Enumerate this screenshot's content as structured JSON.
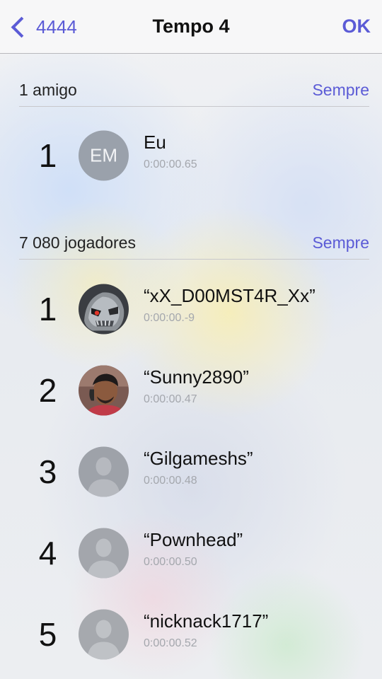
{
  "navbar": {
    "back_label": "4444",
    "title": "Tempo 4",
    "ok_label": "OK"
  },
  "friends": {
    "title": "1 amigo",
    "filter": "Sempre",
    "entries": [
      {
        "rank": "1",
        "name": "Eu",
        "score": "0:00:00.65",
        "avatar": "initials",
        "initials": "EM"
      }
    ]
  },
  "players": {
    "title": "7 080 jogadores",
    "filter": "Sempre",
    "entries": [
      {
        "rank": "1",
        "name": "“xX_D00MST4R_Xx”",
        "score": "0:00:00.-9",
        "avatar": "skull-photo"
      },
      {
        "rank": "2",
        "name": "“Sunny2890”",
        "score": "0:00:00.47",
        "avatar": "person-photo"
      },
      {
        "rank": "3",
        "name": "“Gilgameshs”",
        "score": "0:00:00.48",
        "avatar": "default-silhouette"
      },
      {
        "rank": "4",
        "name": "“Pownhead”",
        "score": "0:00:00.50",
        "avatar": "default-silhouette"
      },
      {
        "rank": "5",
        "name": "“nicknack1717”",
        "score": "0:00:00.52",
        "avatar": "default-silhouette"
      }
    ]
  }
}
